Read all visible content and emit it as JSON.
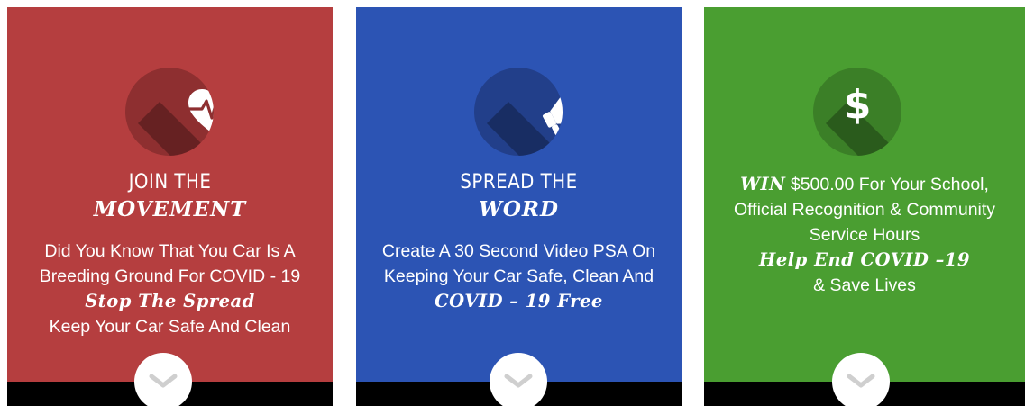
{
  "colors": {
    "red": "#b53e3f",
    "blue": "#2c54b4",
    "green": "#4a9e31",
    "footer": "#000000",
    "chevron": "#cfcfcf"
  },
  "cards": [
    {
      "icon": "heart-pulse-icon",
      "title_plain": "JOIN THE",
      "title_brush": "MOVEMENT",
      "lines": [
        "Did You Know That You Car Is A",
        "Breeding Ground For COVID - 19",
        "Stop The Spread",
        "Keep Your Car Safe And Clean"
      ],
      "chevron_icon": "chevron-down-icon"
    },
    {
      "icon": "megaphone-icon",
      "title_plain": "SPREAD THE",
      "title_brush": "WORD",
      "lines": [
        "Create A 30 Second Video PSA  On",
        "Keeping Your Car Safe, Clean And",
        "COVID – 19 Free"
      ],
      "chevron_icon": "chevron-down-icon"
    },
    {
      "icon": "dollar-icon",
      "dollar_symbol": "$",
      "win_word": "WIN",
      "lines": [
        "$500.00 For Your School,",
        "Official Recognition & Community",
        "Service Hours",
        "Help End COVID –19",
        "& Save Lives"
      ],
      "chevron_icon": "chevron-down-icon"
    }
  ]
}
